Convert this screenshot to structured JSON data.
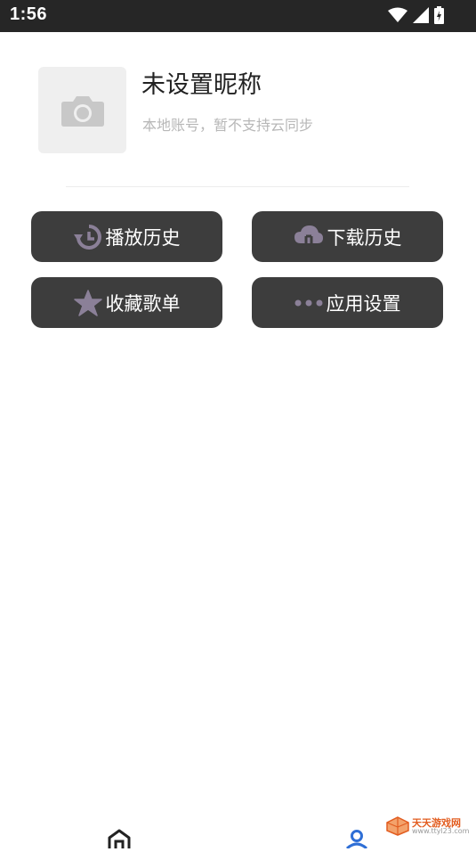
{
  "status_bar": {
    "time": "1:56"
  },
  "profile": {
    "nickname": "未设置昵称",
    "subtitle": "本地账号，暂不支持云同步"
  },
  "menu": [
    {
      "label": "播放历史",
      "icon": "history-icon"
    },
    {
      "label": "下载历史",
      "icon": "cloud-download-icon"
    },
    {
      "label": "收藏歌单",
      "icon": "star-icon"
    },
    {
      "label": "应用设置",
      "icon": "more-dots-icon"
    }
  ],
  "bottom_nav": [
    {
      "icon": "home-icon"
    },
    {
      "icon": "user-icon"
    }
  ],
  "watermark": {
    "title": "天天游戏网",
    "url": "www.ttyl23.com"
  },
  "colors": {
    "status_bar": "#262626",
    "button_bg": "#3d3d3d",
    "icon_accent": "#8b8098",
    "nav_active": "#2f6fd6"
  }
}
